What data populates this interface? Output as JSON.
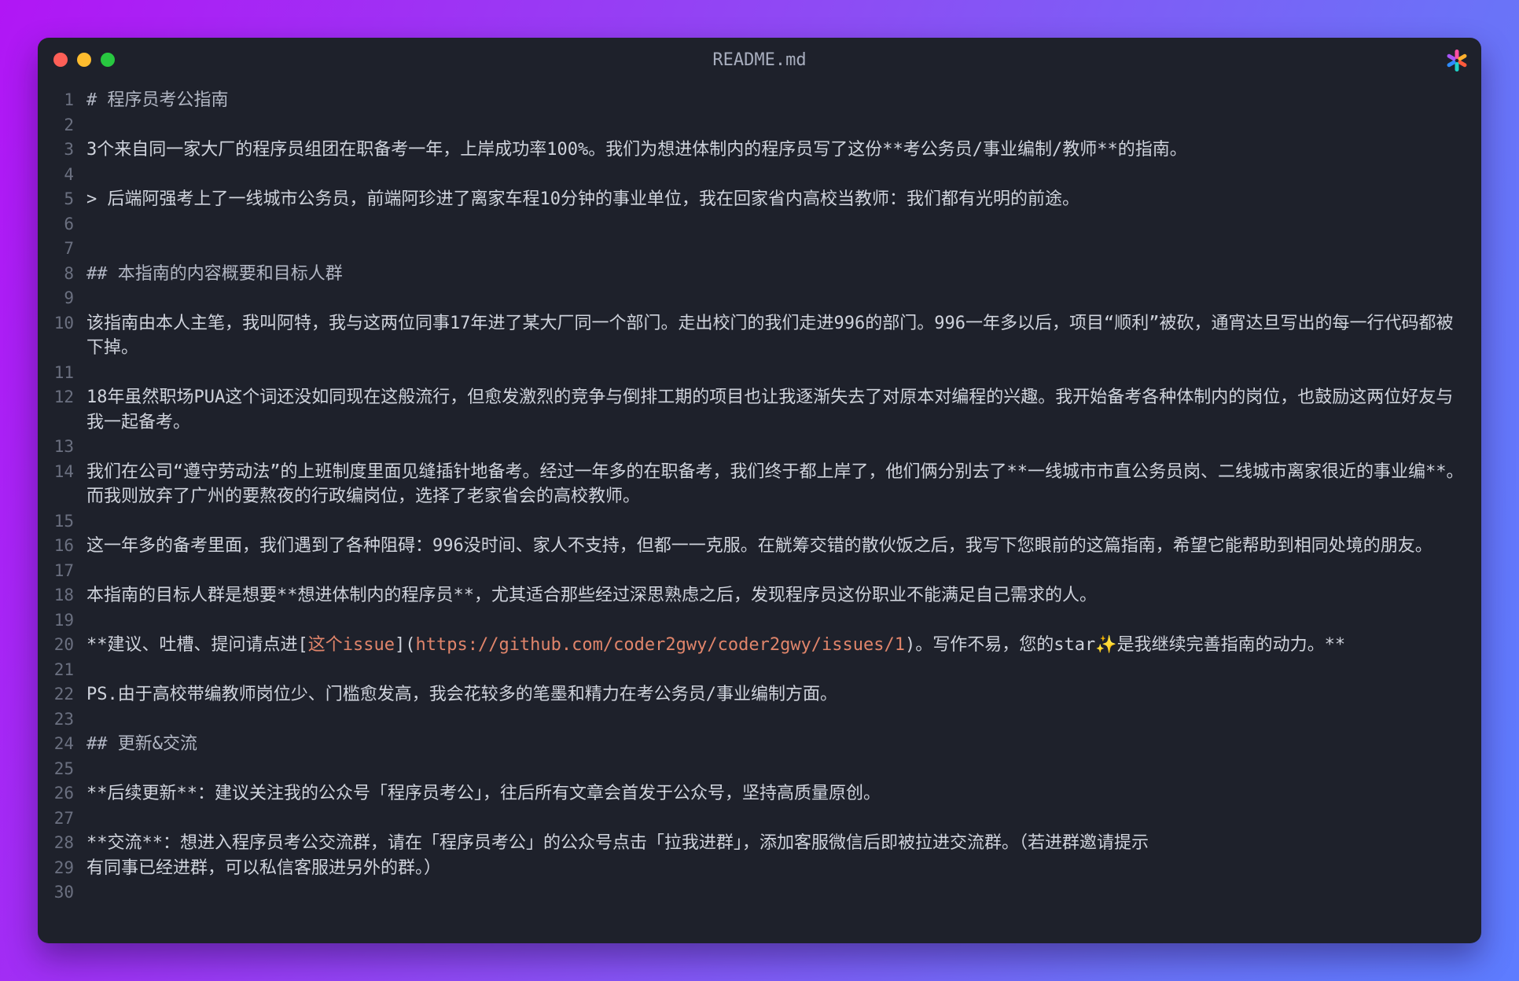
{
  "window": {
    "title": "README.md"
  },
  "editor": {
    "lines": [
      {
        "n": "1",
        "text": "# 程序员考公指南"
      },
      {
        "n": "2",
        "text": ""
      },
      {
        "n": "3",
        "text": "3个来自同一家大厂的程序员组团在职备考一年，上岸成功率100%。我们为想进体制内的程序员写了这份**考公务员/事业编制/教师**的指南。"
      },
      {
        "n": "4",
        "text": ""
      },
      {
        "n": "5",
        "text": "> 后端阿强考上了一线城市公务员，前端阿珍进了离家车程10分钟的事业单位，我在回家省内高校当教师：我们都有光明的前途。"
      },
      {
        "n": "6",
        "text": ""
      },
      {
        "n": "7",
        "text": ""
      },
      {
        "n": "8",
        "text": "## 本指南的内容概要和目标人群"
      },
      {
        "n": "9",
        "text": ""
      },
      {
        "n": "10",
        "text": "该指南由本人主笔，我叫阿特，我与这两位同事17年进了某大厂同一个部门。走出校门的我们走进996的部门。996一年多以后，项目“顺利”被砍，通宵达旦写出的每一行代码都被下掉。"
      },
      {
        "n": "11",
        "text": ""
      },
      {
        "n": "12",
        "text": "18年虽然职场PUA这个词还没如同现在这般流行，但愈发激烈的竞争与倒排工期的项目也让我逐渐失去了对原本对编程的兴趣。我开始备考各种体制内的岗位，也鼓励这两位好友与我一起备考。"
      },
      {
        "n": "13",
        "text": ""
      },
      {
        "n": "14",
        "text": "我们在公司“遵守劳动法”的上班制度里面见缝插针地备考。经过一年多的在职备考，我们终于都上岸了，他们俩分别去了**一线城市市直公务员岗、二线城市离家很近的事业编**。而我则放弃了广州的要熬夜的行政编岗位，选择了老家省会的高校教师。"
      },
      {
        "n": "15",
        "text": ""
      },
      {
        "n": "16",
        "text": "这一年多的备考里面，我们遇到了各种阻碍：996没时间、家人不支持，但都一一克服。在觥筹交错的散伙饭之后，我写下您眼前的这篇指南，希望它能帮助到相同处境的朋友。"
      },
      {
        "n": "17",
        "text": ""
      },
      {
        "n": "18",
        "text": "本指南的目标人群是想要**想进体制内的程序员**，尤其适合那些经过深思熟虑之后，发现程序员这份职业不能满足自己需求的人。"
      },
      {
        "n": "19",
        "text": ""
      },
      {
        "n": "20",
        "text": "",
        "pre": "**建议、吐槽、提问请点进[",
        "link_text": "这个issue",
        "mid": "](",
        "link_url": "https://github.com/coder2gwy/coder2gwy/issues/1",
        "post": ")。写作不易，您的star✨是我继续完善指南的动力。**"
      },
      {
        "n": "21",
        "text": ""
      },
      {
        "n": "22",
        "text": "PS.由于高校带编教师岗位少、门槛愈发高，我会花较多的笔墨和精力在考公务员/事业编制方面。"
      },
      {
        "n": "23",
        "text": ""
      },
      {
        "n": "24",
        "text": "## 更新&交流"
      },
      {
        "n": "25",
        "text": ""
      },
      {
        "n": "26",
        "text": "**后续更新**：建议关注我的公众号「程序员考公」，往后所有文章会首发于公众号，坚持高质量原创。"
      },
      {
        "n": "27",
        "text": ""
      },
      {
        "n": "28",
        "text": "**交流**：想进入程序员考公交流群，请在「程序员考公」的公众号点击「拉我进群」，添加客服微信后即被拉进交流群。（若进群邀请提示"
      },
      {
        "n": "29",
        "text": "有同事已经进群，可以私信客服进另外的群。）"
      },
      {
        "n": "30",
        "text": ""
      }
    ]
  },
  "icons": {
    "logo": "pinwheel-logo-icon"
  }
}
